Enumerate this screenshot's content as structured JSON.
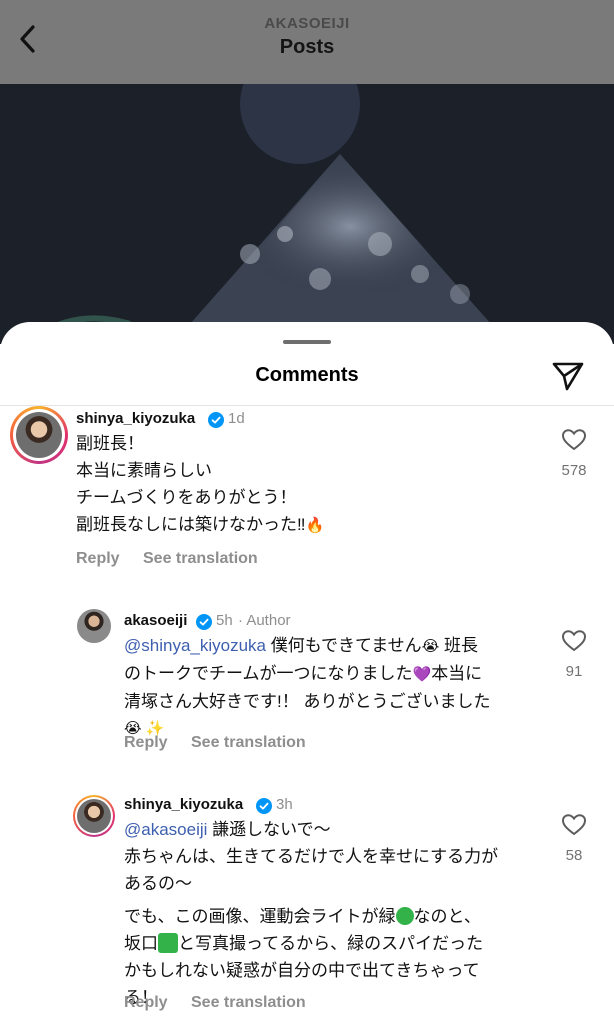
{
  "header": {
    "account": "AKASOEIJI",
    "title": "Posts",
    "back_icon": "chevron-left-icon"
  },
  "sheet": {
    "title": "Comments",
    "share_icon": "send-icon"
  },
  "comments": [
    {
      "username": "shinya_kiyozuka",
      "verified": true,
      "time": "1d",
      "lines": [
        "副班長！",
        "本当に素晴らしい",
        "チームづくりをありがとう！",
        "副班長なしには築けなかった‼"
      ],
      "emoji_end": "🔥",
      "likes": "578",
      "reply_label": "Reply",
      "translate_label": "See translation"
    },
    {
      "username": "akasoeiji",
      "verified": true,
      "time": "5h",
      "author_tag": "· Author",
      "mention": "@shinya_kiyozuka",
      "line1_rest": " 僕何もできてません",
      "emoji1": "😭",
      "line1_tail": " 班長",
      "line2": "のトークでチームが一つになりました",
      "emoji2": "💜",
      "line2_tail": "本当に",
      "line3": "清塚さん大好きです!！ ありがとうございました",
      "emoji3": "😭 ✨",
      "likes": "91",
      "reply_label": "Reply",
      "translate_label": "See translation"
    },
    {
      "username": "shinya_kiyozuka",
      "verified": true,
      "time": "3h",
      "mention": "@akasoeiji",
      "line1_rest": " 謙遜しないで～",
      "line2": "赤ちゃんは、生きてるだけで人を幸せにする力が",
      "line3": "あるの～",
      "line4a": "でも、この画像、運動会ライトが緑",
      "line4b": "なのと、",
      "line5a": "坂口",
      "line5b": "と写真撮ってるから、緑のスパイだった",
      "line6": "かもしれない疑惑が自分の中で出てきちゃって",
      "line7": "る！",
      "likes": "58",
      "reply_label": "Reply",
      "translate_label": "See translation"
    }
  ],
  "colors": {
    "mention": "#3d5fae",
    "verified": "#0095f6",
    "muted": "#8e8e8e",
    "header_overlay": "#7a7a7a"
  }
}
